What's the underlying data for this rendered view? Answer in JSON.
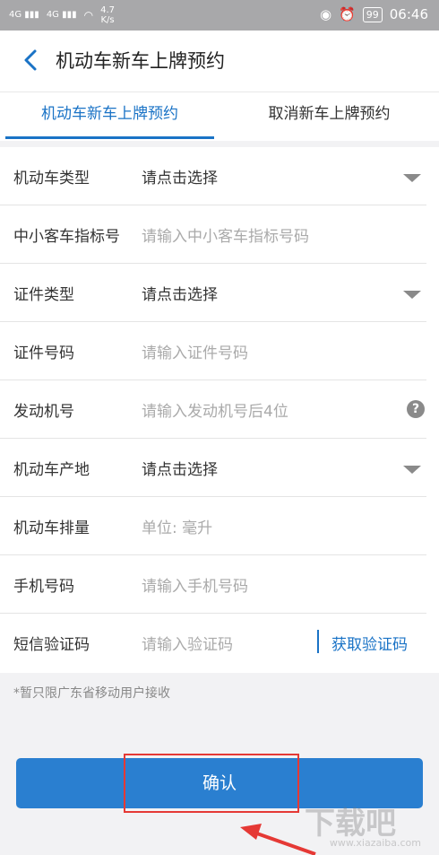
{
  "status_bar": {
    "signal1": "4G",
    "signal2": "4G",
    "net_speed": "4.7",
    "net_unit": "K/s",
    "battery": "99",
    "time": "06:46"
  },
  "header": {
    "title": "机动车新车上牌预约"
  },
  "tabs": [
    {
      "label": "机动车新车上牌预约",
      "active": true
    },
    {
      "label": "取消新车上牌预约",
      "active": false
    }
  ],
  "form": {
    "rows": [
      {
        "label": "机动车类型",
        "value": "请点击选择",
        "kind": "select"
      },
      {
        "label": "中小客车指标号",
        "value": "请输入中小客车指标号码",
        "kind": "input"
      },
      {
        "label": "证件类型",
        "value": "请点击选择",
        "kind": "select"
      },
      {
        "label": "证件号码",
        "value": "请输入证件号码",
        "kind": "input"
      },
      {
        "label": "发动机号",
        "value": "请输入发动机号后4位",
        "kind": "input-help"
      },
      {
        "label": "机动车产地",
        "value": "请点击选择",
        "kind": "select"
      },
      {
        "label": "机动车排量",
        "value": "单位: 毫升",
        "kind": "input"
      },
      {
        "label": "手机号码",
        "value": "请输入手机号码",
        "kind": "input"
      },
      {
        "label": "短信验证码",
        "value": "请输入验证码",
        "kind": "input-code",
        "action": "获取验证码"
      }
    ]
  },
  "note": "*暂只限广东省移动用户接收",
  "confirm_label": "确认",
  "watermark": {
    "brand": "下载吧",
    "url": "www.xiazaiba.com"
  },
  "colors": {
    "accent": "#1a73c6",
    "button": "#2a7fd0",
    "highlight": "#e53935"
  }
}
